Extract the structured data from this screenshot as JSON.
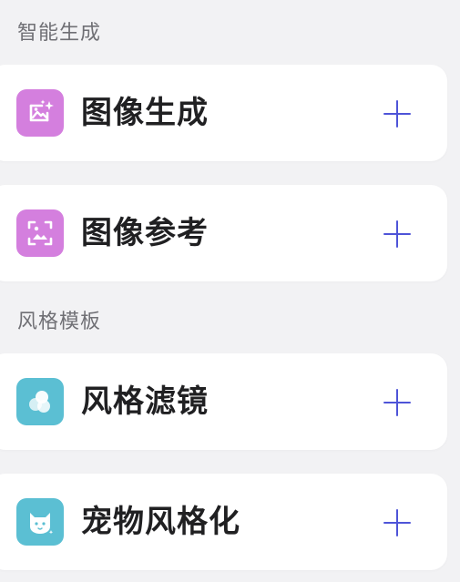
{
  "sections": [
    {
      "title": "智能生成",
      "items": [
        {
          "label": "图像生成",
          "icon": "image-generate-icon",
          "icon_color": "#d47fde"
        },
        {
          "label": "图像参考",
          "icon": "image-reference-icon",
          "icon_color": "#d47fde"
        }
      ]
    },
    {
      "title": "风格模板",
      "items": [
        {
          "label": "风格滤镜",
          "icon": "style-filter-icon",
          "icon_color": "#5bbfd3"
        },
        {
          "label": "宠物风格化",
          "icon": "pet-stylize-icon",
          "icon_color": "#5bbfd3"
        }
      ]
    }
  ],
  "colors": {
    "background": "#f2f2f4",
    "card": "#ffffff",
    "accent": "#4e54d8",
    "section_title": "#707075"
  }
}
